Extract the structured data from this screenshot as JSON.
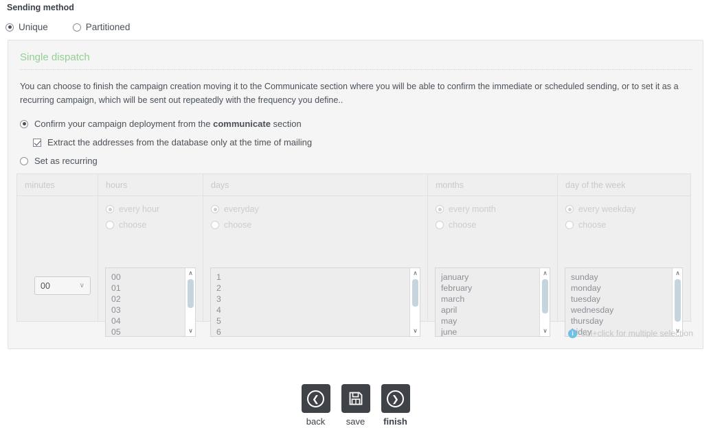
{
  "sending_method": {
    "title": "Sending method",
    "options": [
      {
        "label": "Unique",
        "selected": true
      },
      {
        "label": "Partitioned",
        "selected": false
      }
    ]
  },
  "panel": {
    "title": "Single dispatch",
    "description": "You can choose to finish the campaign creation moving it to the Communicate section where you will be able to confirm the immediate or scheduled sending, or to set it as a recurring campaign, which will be sent out repeatedly with the frequency you define..",
    "choices": {
      "confirm_prefix": "Confirm your campaign deployment from the ",
      "confirm_bold": "communicate",
      "confirm_suffix": " section",
      "extract_label": "Extract the addresses from the database only at the time of mailing",
      "recurring_label": "Set as recurring"
    },
    "hint": "ctrl+click for multiple selection",
    "hint_icon": "info-icon"
  },
  "schedule": {
    "columns": [
      {
        "header": "minutes"
      },
      {
        "header": "hours"
      },
      {
        "header": "days"
      },
      {
        "header": "months"
      },
      {
        "header": "day of the week"
      }
    ],
    "minutes": {
      "value": "00",
      "chevron": "∨"
    },
    "hours": {
      "every_label": "every hour",
      "choose_label": "choose",
      "items": [
        "00",
        "01",
        "02",
        "03",
        "04",
        "05"
      ]
    },
    "days": {
      "every_label": "everyday",
      "choose_label": "choose",
      "items": [
        "1",
        "2",
        "3",
        "4",
        "5",
        "6"
      ]
    },
    "months": {
      "every_label": "every month",
      "choose_label": "choose",
      "items": [
        "january",
        "february",
        "march",
        "april",
        "may",
        "june"
      ]
    },
    "weekday": {
      "every_label": "every weekday",
      "choose_label": "choose",
      "items": [
        "sunday",
        "monday",
        "tuesday",
        "wednesday",
        "thursday",
        "friday"
      ]
    },
    "scroll_up": "∧",
    "scroll_down": "∨"
  },
  "actions": [
    {
      "label": "back",
      "icon": "chevron-left-circle-icon",
      "glyph": "❮",
      "bold": false
    },
    {
      "label": "save",
      "icon": "floppy-disk-icon",
      "glyph": "",
      "bold": false
    },
    {
      "label": "finish",
      "icon": "chevron-right-circle-icon",
      "glyph": "❯",
      "bold": true
    }
  ],
  "colors": {
    "panel_title": "#93cf93",
    "button_bg": "#3f4247",
    "info_blue": "#6ec1e4",
    "panel_bg": "#f5f5f5"
  }
}
